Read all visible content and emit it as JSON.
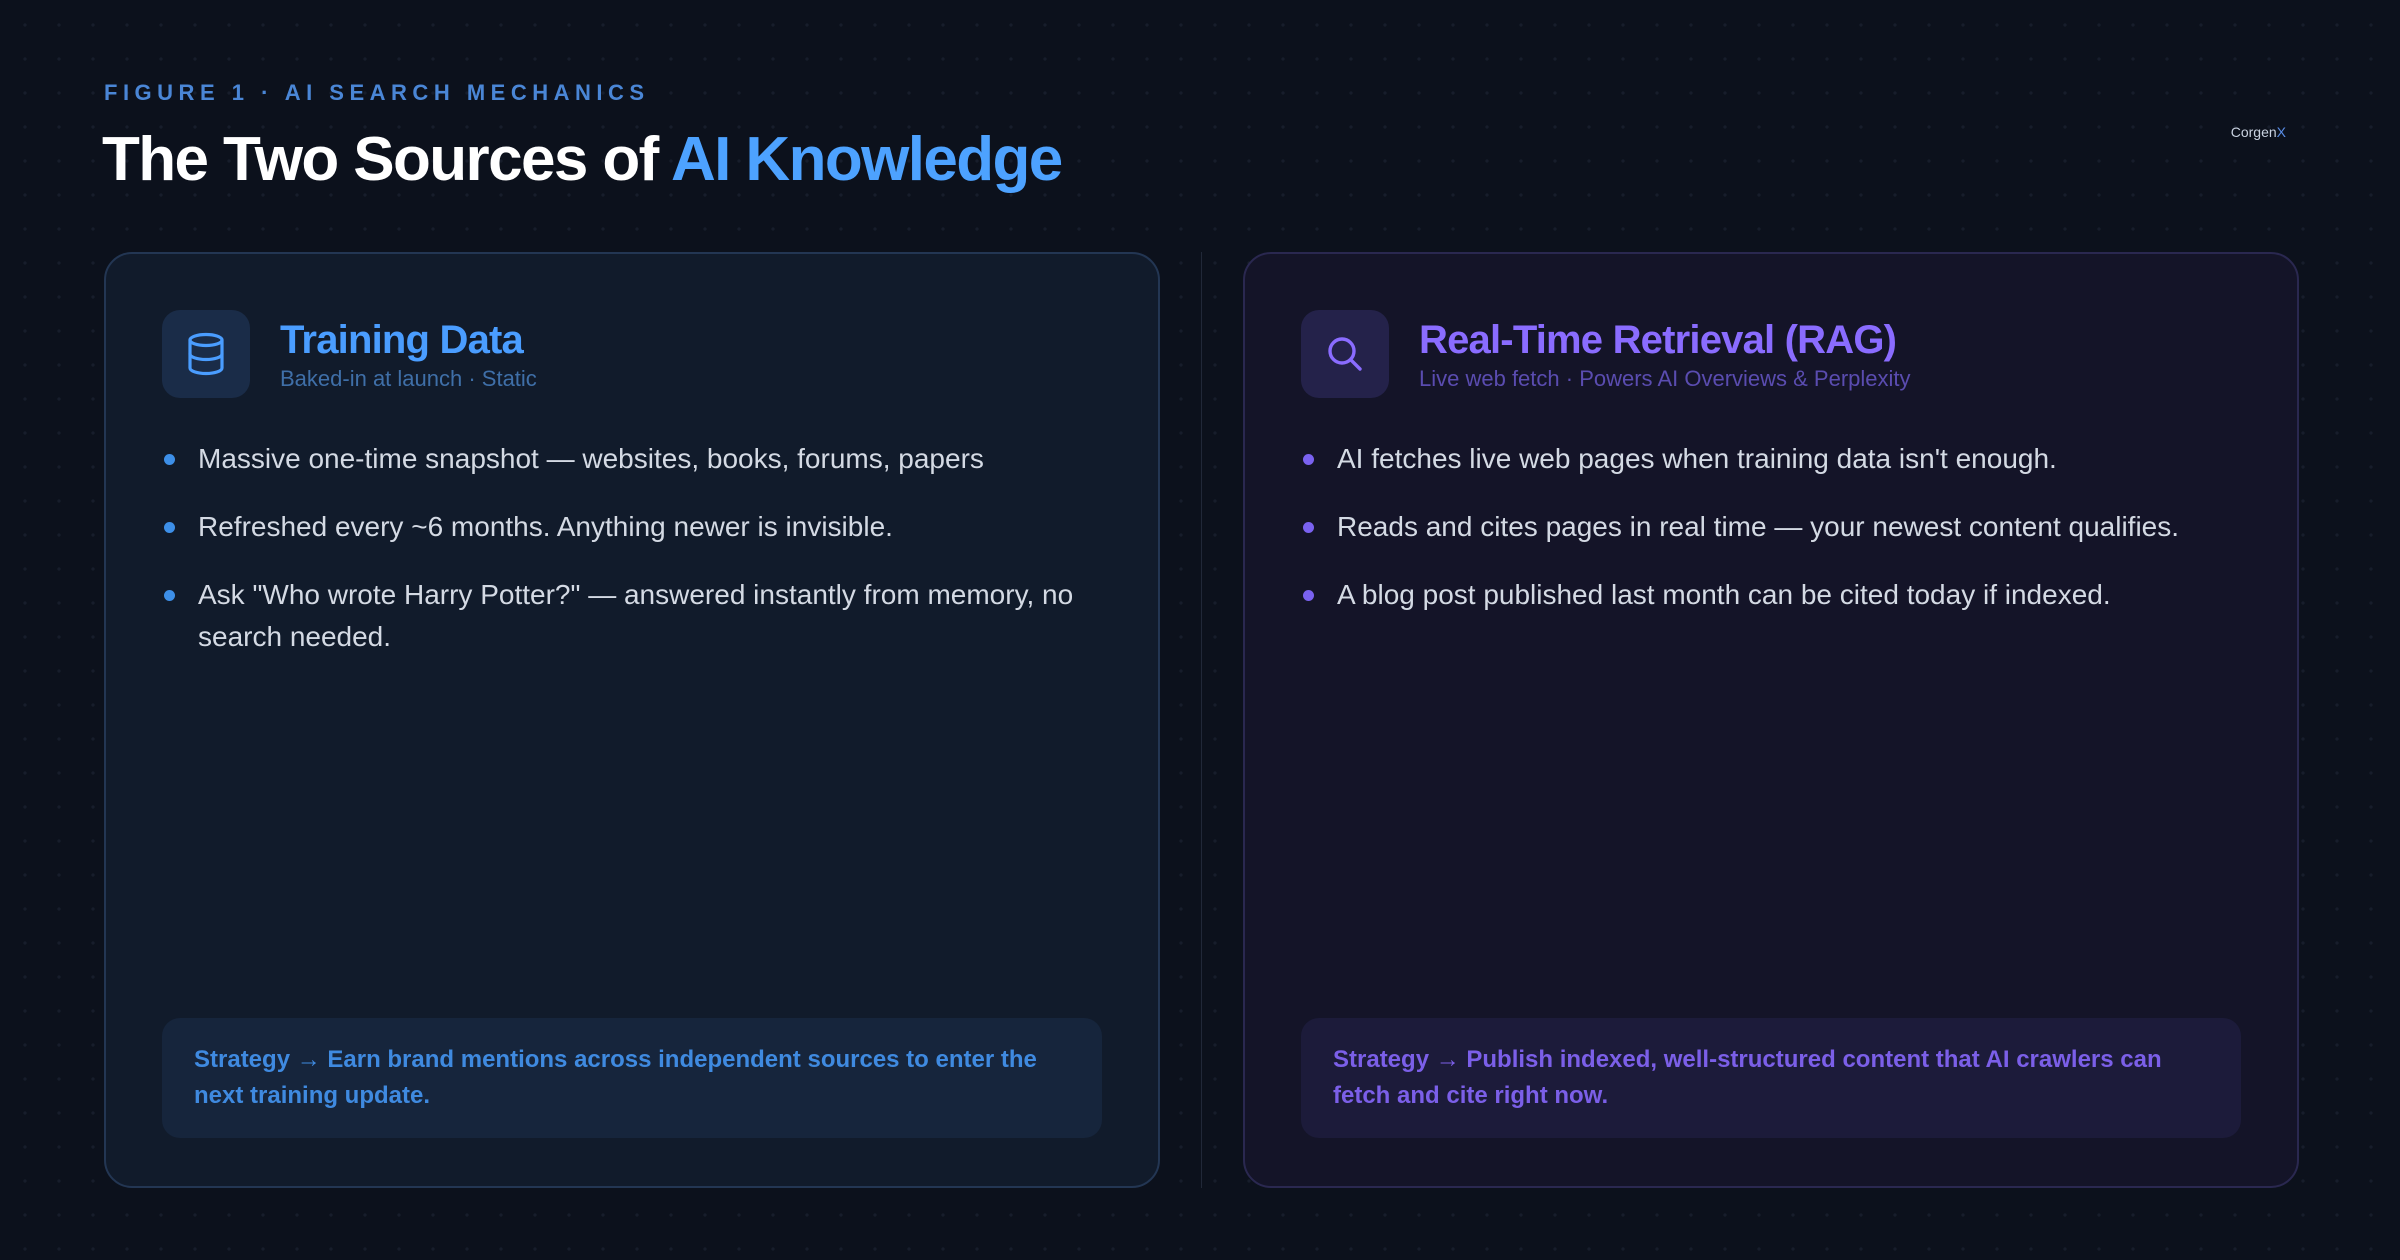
{
  "header": {
    "eyebrow": "FIGURE 1 · AI SEARCH MECHANICS",
    "title_main": "The Two Sources of ",
    "title_accent": "AI Knowledge",
    "brand_main": "Corgen",
    "brand_accent": "X"
  },
  "cards": [
    {
      "icon": "database-icon",
      "title": "Training Data",
      "subtitle": "Baked-in at launch · Static",
      "bullets": [
        "Massive one-time snapshot — websites, books, forums, papers",
        "Refreshed every ~6 months. Anything newer is invisible.",
        "Ask \"Who wrote Harry Potter?\" — answered instantly from memory, no search needed."
      ],
      "strategy": "Strategy → Earn brand mentions across independent sources to enter the next training update."
    },
    {
      "icon": "search-icon",
      "title": "Real-Time Retrieval (RAG)",
      "subtitle": "Live web fetch · Powers AI Overviews & Perplexity",
      "bullets": [
        "AI fetches live web pages when training data isn't enough.",
        "Reads and cites pages in real time — your newest content qualifies.",
        "A blog post published last month can be cited today if indexed."
      ],
      "strategy": "Strategy → Publish indexed, well-structured content that AI crawlers can fetch and cite right now."
    }
  ],
  "colors": {
    "background": "#0c111c",
    "training_accent": "#4a9dff",
    "rag_accent": "#8a6cff"
  }
}
